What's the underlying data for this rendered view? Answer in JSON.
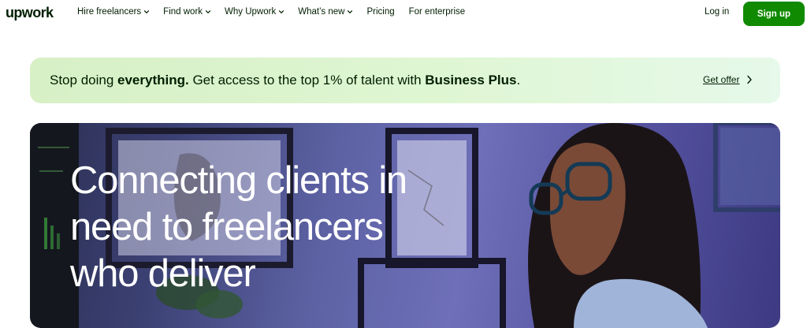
{
  "nav": {
    "logo": "upwork",
    "links": [
      {
        "label": "Hire freelancers",
        "has_dropdown": true
      },
      {
        "label": "Find work",
        "has_dropdown": true
      },
      {
        "label": "Why Upwork",
        "has_dropdown": true
      },
      {
        "label": "What’s new",
        "has_dropdown": true
      },
      {
        "label": "Pricing",
        "has_dropdown": false
      },
      {
        "label": "For enterprise",
        "has_dropdown": false
      }
    ],
    "login": "Log in",
    "signup": "Sign up"
  },
  "promo": {
    "part1": "Stop doing ",
    "bold1": "everything.",
    "part2": " Get access to the top 1% of talent with ",
    "bold2": "Business Plus",
    "part3": ".",
    "cta": "Get offer"
  },
  "hero": {
    "line1": "Connecting clients in",
    "line2": "need to freelancers",
    "line3": "who deliver"
  },
  "colors": {
    "brand_green": "#108a00",
    "text_dark": "#001e00",
    "promo_bg": "#dff6d3"
  },
  "icons": {
    "dropdown": "chevron-down-icon",
    "promo_arrow": "chevron-right-icon"
  }
}
